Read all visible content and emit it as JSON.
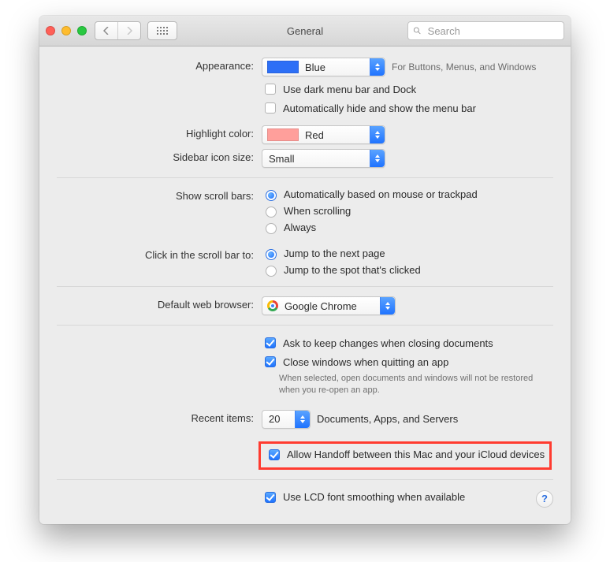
{
  "window": {
    "title": "General"
  },
  "search": {
    "placeholder": "Search"
  },
  "labels": {
    "appearance": "Appearance:",
    "highlight": "Highlight color:",
    "sidebar": "Sidebar icon size:",
    "scrollbars": "Show scroll bars:",
    "scrollclick": "Click in the scroll bar to:",
    "browser": "Default web browser:",
    "recent": "Recent items:"
  },
  "appearance": {
    "value": "Blue",
    "hint": "For Buttons, Menus, and Windows",
    "dark_menu": "Use dark menu bar and Dock",
    "auto_hide": "Automatically hide and show the menu bar",
    "swatch": "#2d6ff6"
  },
  "highlight": {
    "value": "Red",
    "swatch": "#ff9f9b"
  },
  "sidebar_size": {
    "value": "Small"
  },
  "scroll_show": {
    "opt1": "Automatically based on mouse or trackpad",
    "opt2": "When scrolling",
    "opt3": "Always"
  },
  "scroll_click": {
    "opt1": "Jump to the next page",
    "opt2": "Jump to the spot that's clicked"
  },
  "browser": {
    "value": "Google Chrome"
  },
  "documents": {
    "ask_keep": "Ask to keep changes when closing documents",
    "close_windows": "Close windows when quitting an app",
    "close_hint": "When selected, open documents and windows will not be restored when you re-open an app."
  },
  "recent": {
    "value": "20",
    "hint": "Documents, Apps, and Servers"
  },
  "handoff": "Allow Handoff between this Mac and your iCloud devices",
  "lcd": "Use LCD font smoothing when available"
}
